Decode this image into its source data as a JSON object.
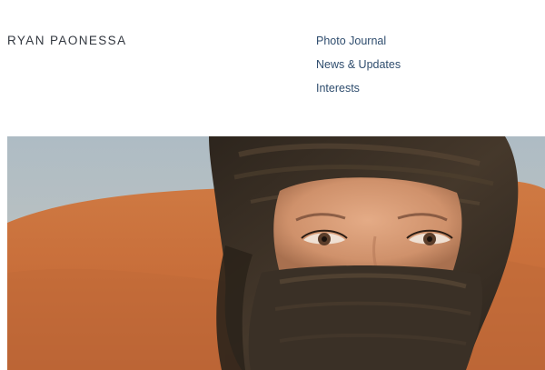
{
  "header": {
    "site_title": "RYAN PAONESSA"
  },
  "nav": {
    "items": [
      {
        "label": "Photo Journal"
      },
      {
        "label": "News & Updates"
      },
      {
        "label": "Interests"
      }
    ]
  },
  "hero": {
    "image_subject": "portrait-photo",
    "colors": {
      "sky": "#b6c2c9",
      "dune": "#c9743f",
      "wrap": "#3b2f24",
      "skin": "#d9a07b"
    }
  }
}
